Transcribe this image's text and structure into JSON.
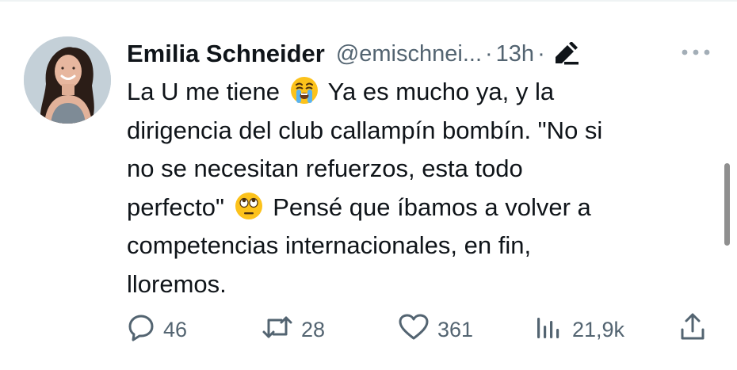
{
  "tweet": {
    "author_name": "Emilia Schneider",
    "handle": "@emischnei...",
    "separator": "·",
    "time": "13h",
    "text_lines": [
      {
        "before": "La U me tiene ",
        "emoji": "loudly-crying-face",
        "after": " Ya es mucho ya, y la"
      },
      {
        "text": "dirigencia del club callampín bombín. \"No si"
      },
      {
        "text": "no se necesitan refuerzos, esta todo"
      },
      {
        "before": "perfecto\" ",
        "emoji": "face-with-rolling-eyes",
        "after": " Pensé que íbamos a volver a"
      },
      {
        "text": "competencias internacionales, en fin,"
      },
      {
        "text": "lloremos."
      }
    ],
    "actions": {
      "replies": "46",
      "retweets": "28",
      "likes": "361",
      "views": "21,9k"
    }
  },
  "icons": {
    "avatar": "profile-photo",
    "edited": "pencil-icon",
    "more": "more-horizontal-icon",
    "reply": "reply-icon",
    "retweet": "retweet-icon",
    "like": "heart-icon",
    "views": "views-bar-chart-icon",
    "share": "share-icon"
  },
  "colors": {
    "text_primary": "#0f1419",
    "text_secondary": "#536471",
    "emoji_yellow": "#fcc21b"
  }
}
